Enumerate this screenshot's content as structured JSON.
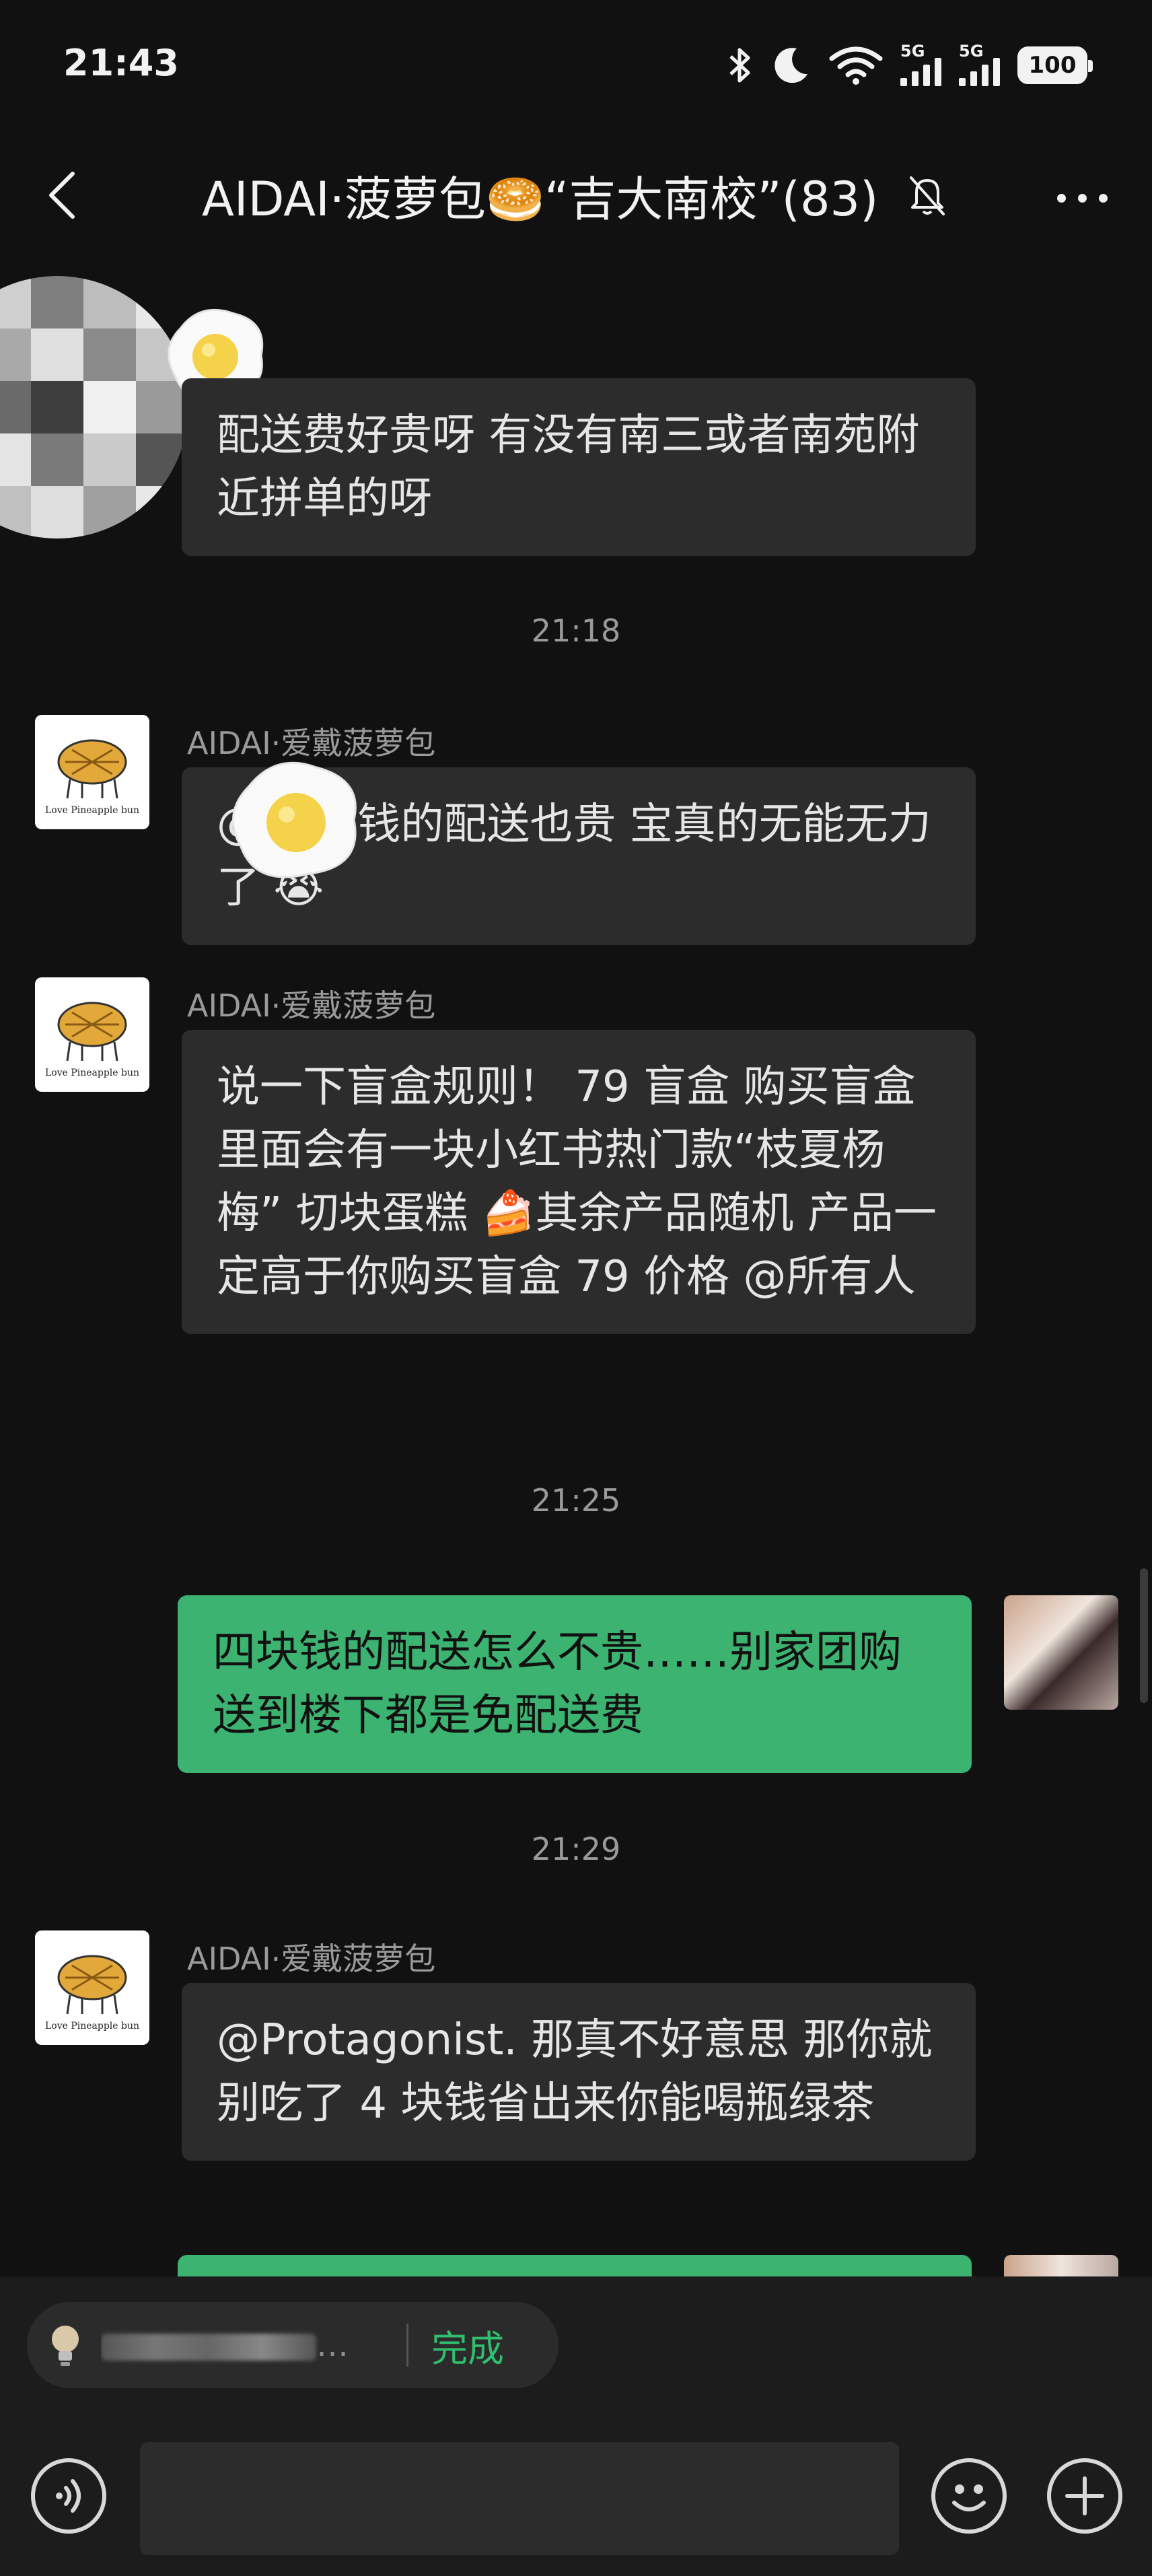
{
  "status_bar": {
    "time": "21:43",
    "signal_label_1": "5G",
    "signal_label_2": "5G",
    "battery": "100",
    "icons": [
      "bluetooth-icon",
      "moon-icon",
      "wifi-icon",
      "signal-icon",
      "battery-icon"
    ]
  },
  "header": {
    "title": "AIDAI·菠萝包🥯“吉大南校”(83)",
    "icons": [
      "back-icon",
      "mute-bell-icon",
      "more-icon"
    ]
  },
  "messages": [
    {
      "type": "text",
      "side": "left",
      "sender": "",
      "text": "配送费好贵呀 有没有南三或者南苑附近拼单的呀"
    },
    {
      "type": "time",
      "text": "21:18"
    },
    {
      "type": "text",
      "side": "left",
      "sender": "AIDAI·爱戴菠萝包",
      "text": "@      4 块钱的配送也贵 宝真的无能无力了 😭"
    },
    {
      "type": "text",
      "side": "left",
      "sender": "AIDAI·爱戴菠萝包",
      "text": "说一下盲盒规则！ 79 盲盒 购买盲盒里面会有一块小红书热门款“枝夏杨梅” 切块蛋糕 🍰其余产品随机 产品一定高于你购买盲盒 79 价格 @所有人"
    },
    {
      "type": "time",
      "text": "21:25"
    },
    {
      "type": "text",
      "side": "right",
      "sender": "",
      "text": "四块钱的配送怎么不贵……别家团购送到楼下都是免配送费"
    },
    {
      "type": "time",
      "text": "21:29"
    },
    {
      "type": "text",
      "side": "left",
      "sender": "AIDAI·爱戴菠萝包",
      "text": "@Protagonist. 那真不好意思 那你就别吃了 4 块钱省出来你能喝瓶绿茶"
    }
  ],
  "avatar_logo_text": "Love Pineapple bun",
  "reply": {
    "quote_text": "…",
    "done_label": "完成"
  },
  "input_bar": {
    "icons": [
      "voice-icon",
      "emoji-icon",
      "plus-icon"
    ]
  },
  "colors": {
    "background": "#111111",
    "bubble_other": "#2c2c2c",
    "bubble_self": "#3cb371",
    "accent_green": "#2fbf6e"
  }
}
